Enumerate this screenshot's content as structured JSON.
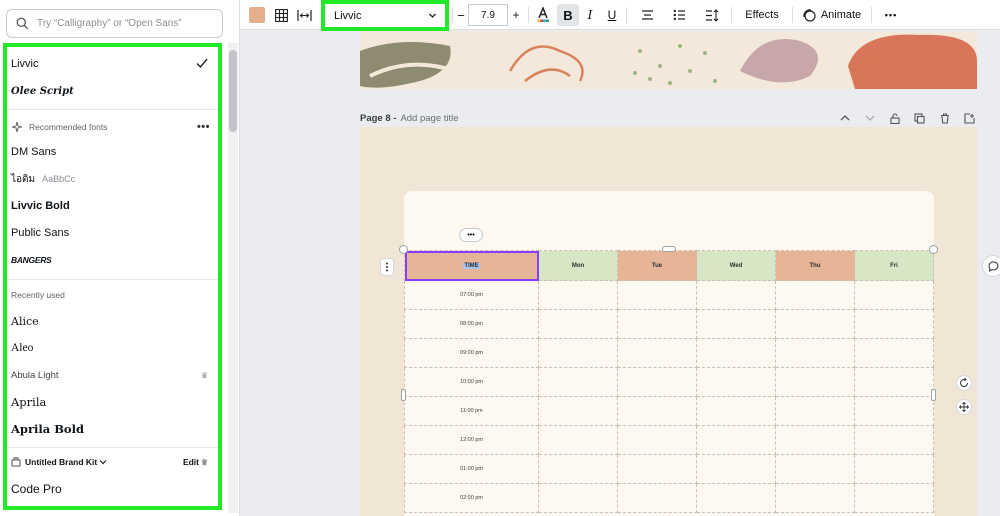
{
  "search": {
    "placeholder": "Try “Calligraphy” or “Open Sans”"
  },
  "fonts": {
    "current": [
      {
        "label": "Livvic",
        "selected": true
      },
      {
        "label": "Olee Script"
      }
    ],
    "recommended": {
      "heading": "Recommended fonts",
      "items": [
        "DM Sans",
        "ไอติม",
        "Livvic Bold",
        "Public Sans",
        "BANGERS"
      ],
      "thai_sample": "AaBbCc"
    },
    "recent": {
      "heading": "Recently used",
      "items": [
        "Alice",
        "Aleo",
        "Abula Light",
        "Aprila",
        "Aprila Bold"
      ]
    },
    "brand": {
      "heading": "Untitled Brand Kit",
      "edit_label": "Edit",
      "items": [
        "Code Pro"
      ]
    }
  },
  "toolbar": {
    "text_color": "#e5b08e",
    "font_name": "Livvic",
    "size": "7.9",
    "bold": "B",
    "italic": "I",
    "underline": "U",
    "effects": "Effects",
    "animate": "Animate",
    "minus": "−",
    "plus": "+",
    "more": "•••"
  },
  "page8": {
    "title": "Page 8 - ",
    "subtitle": "Add page title"
  },
  "table": {
    "headers": [
      "TIME",
      "Mon",
      "Tue",
      "Wed",
      "Thu",
      "Fri"
    ],
    "times": [
      "07:00 pm",
      "08:00 pm",
      "09:00 pm",
      "10:00 pm",
      "11:00 pm",
      "12:00 pm",
      "01:00 pm",
      "02:00 pm"
    ],
    "more_button": "•••"
  },
  "colors": {
    "highlight": "#22e82a",
    "orange_header": "#e6b598",
    "green_header": "#d7e7c6",
    "selection": "#8b3dff"
  }
}
